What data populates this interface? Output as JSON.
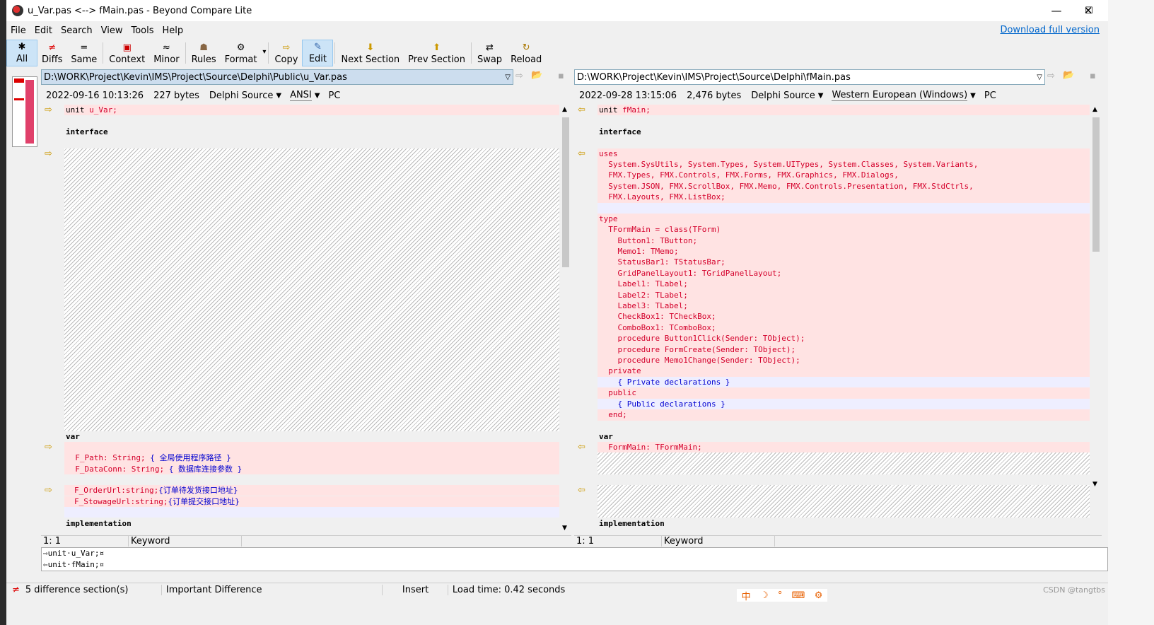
{
  "window": {
    "title": "u_Var.pas <--> fMain.pas - Beyond Compare Lite",
    "min": "—",
    "max": "☐",
    "close": "✕"
  },
  "menu": [
    "File",
    "Edit",
    "Search",
    "View",
    "Tools",
    "Help"
  ],
  "download_link": "Download full version",
  "toolbar": [
    {
      "icon": "asterisk-icon",
      "glyph": "✱",
      "label": "All",
      "active": true
    },
    {
      "icon": "diffs-icon",
      "glyph": "≠",
      "label": "Diffs"
    },
    {
      "icon": "same-icon",
      "glyph": "=",
      "label": "Same"
    },
    {
      "icon": "context-icon",
      "glyph": "▣",
      "label": "Context"
    },
    {
      "icon": "minor-icon",
      "glyph": "≈",
      "label": "Minor"
    },
    {
      "icon": "rules-icon",
      "glyph": "☗",
      "label": "Rules"
    },
    {
      "icon": "format-icon",
      "glyph": "⚙",
      "label": "Format",
      "dropdown": "▾"
    },
    {
      "icon": "copy-icon",
      "glyph": "⇨",
      "label": "Copy"
    },
    {
      "icon": "edit-icon",
      "glyph": "✎",
      "label": "Edit",
      "active": true
    },
    {
      "icon": "next-section-icon",
      "glyph": "⬇",
      "label": "Next Section"
    },
    {
      "icon": "prev-section-icon",
      "glyph": "⬆",
      "label": "Prev Section"
    },
    {
      "icon": "swap-icon",
      "glyph": "⇄",
      "label": "Swap"
    },
    {
      "icon": "reload-icon",
      "glyph": "↻",
      "label": "Reload"
    }
  ],
  "left": {
    "path": "D:\\WORK\\Project\\Kevin\\IMS\\Project\\Source\\Delphi\\Public\\u_Var.pas",
    "date": "2022-09-16 10:13:26",
    "size": "227 bytes",
    "format": "Delphi Source",
    "encoding": "ANSI",
    "lineend": "PC",
    "cursor": "1: 1",
    "mode": "Keyword"
  },
  "right": {
    "path": "D:\\WORK\\Project\\Kevin\\IMS\\Project\\Source\\Delphi\\fMain.pas",
    "date": "2022-09-28 13:15:06",
    "size": "2,476 bytes",
    "format": "Delphi Source",
    "encoding": "Western European (Windows)",
    "lineend": "PC",
    "cursor": "1: 1",
    "mode": "Keyword"
  },
  "left_code": {
    "l1a": "unit ",
    "l1b": "u_Var;",
    "l3": "interface",
    "var": "var",
    "p1a": "  F_Path: String; ",
    "p1b": "{ 全局使用程序路径 }",
    "p2a": "  F_DataConn: String; ",
    "p2b": "{ 数据库连接参数 }",
    "p3a": "F_OrderUrl:string;",
    "p3b": "{订单待发货接口地址}",
    "p4a": "F_StowageUrl:string;",
    "p4b": "{订单提交接口地址}",
    "impl": "implementation"
  },
  "right_code": {
    "l1a": "unit ",
    "l1b": "fMain;",
    "l3": "interface",
    "uses": "uses",
    "u1": "  System.SysUtils, System.Types, System.UITypes, System.Classes, System.Variants,",
    "u2": "  FMX.Types, FMX.Controls, FMX.Forms, FMX.Graphics, FMX.Dialogs,",
    "u3": "  System.JSON, FMX.ScrollBox, FMX.Memo, FMX.Controls.Presentation, FMX.StdCtrls,",
    "u4": "  FMX.Layouts, FMX.ListBox;",
    "type": "type",
    "t1": "  TFormMain = class(TForm)",
    "t2": "    Button1: TButton;",
    "t3": "    Memo1: TMemo;",
    "t4": "    StatusBar1: TStatusBar;",
    "t5": "    GridPanelLayout1: TGridPanelLayout;",
    "t6": "    Label1: TLabel;",
    "t7": "    Label2: TLabel;",
    "t8": "    Label3: TLabel;",
    "t9": "    CheckBox1: TCheckBox;",
    "t10": "    ComboBox1: TComboBox;",
    "t11": "    procedure Button1Click(Sender: TObject);",
    "t12": "    procedure FormCreate(Sender: TObject);",
    "t13": "    procedure Memo1Change(Sender: TObject);",
    "t14": "  private",
    "t15": "    { Private declarations }",
    "t16": "  public",
    "t17": "    { Public declarations }",
    "t18": "  end;",
    "var": "var",
    "v1": "  FormMain: TFormMain;",
    "impl": "implementation"
  },
  "line_compare": {
    "l1": "⇨unit·u_Var;¤",
    "l2": "⇦unit·fMain;¤"
  },
  "statusbar": {
    "diff_icon": "≠",
    "sections": "5 difference section(s)",
    "importance": "Important Difference",
    "mode": "Insert",
    "load": "Load time: 0.42 seconds"
  },
  "watermark": "CSDN @tangtbs",
  "ime": [
    "中",
    "☽",
    "°",
    "⌨",
    "⚙"
  ],
  "colors": {
    "diff": "#ffe3e3",
    "changed": "#d4002b",
    "comment": "#0000d0",
    "active_tb": "#cce4f7"
  }
}
